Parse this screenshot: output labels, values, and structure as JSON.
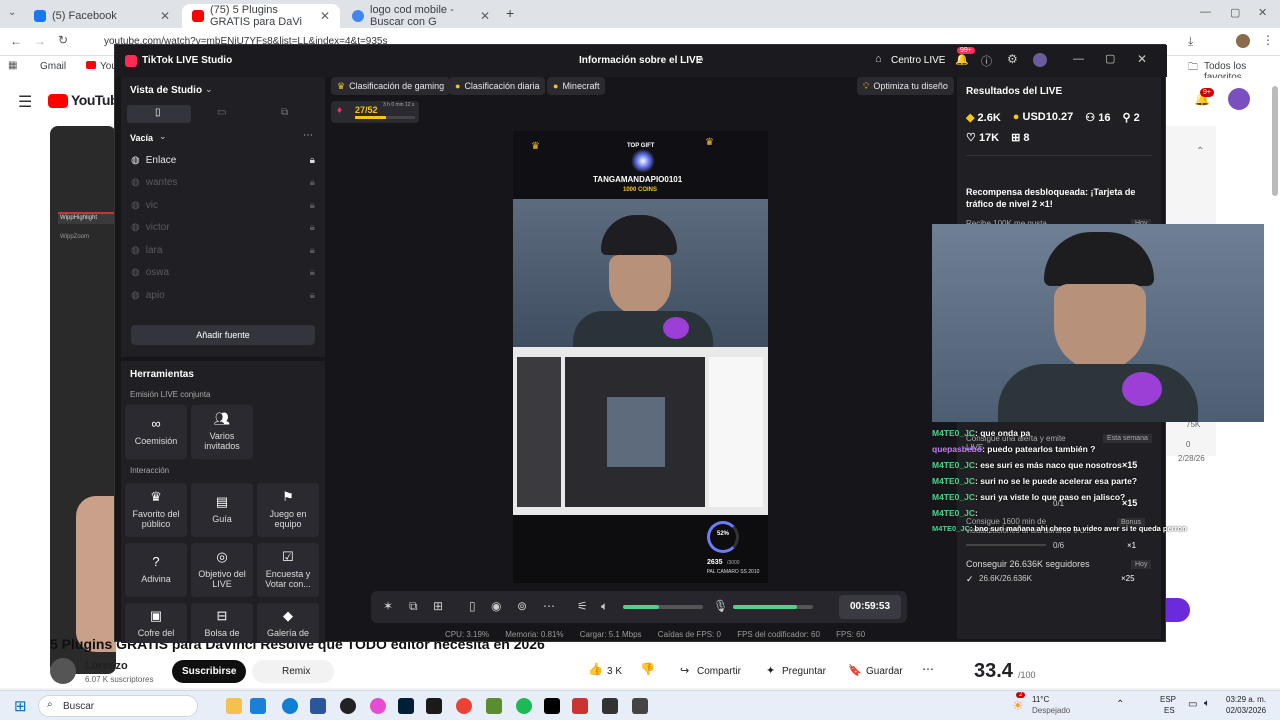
{
  "browser": {
    "tabs": [
      {
        "label": "(5) Facebook",
        "color": "#1877f2"
      },
      {
        "label": "(75) 5 Plugins GRATIS para DaVi",
        "color": "#ff0000"
      },
      {
        "label": "logo cod mobile - Buscar con G",
        "color": "#4285f4"
      }
    ],
    "url": "youtube.com/watch?v=mbENiU7YFs8&list=LL&index=4&t=935s",
    "bookmarks": [
      "Gmail",
      "You"
    ],
    "all_bookmarks": "Todos los favoritos"
  },
  "youtube": {
    "logo": "YouTube",
    "notif_badge": "9+",
    "video_title": "5 Plugins GRATIS para DaVinci Resolve que TODO editor necesita en 2026",
    "channel": "Lorenzo",
    "subs": "6.07 K suscriptores",
    "subscribe": "Suscribirse",
    "remix": "Remix",
    "likes": "3 K",
    "share": "Compartir",
    "ask": "Preguntar",
    "save": "Guardar",
    "score": "33.4",
    "score_unit": "/100",
    "side_vals": [
      "75K",
      "0",
      "2/28/26"
    ],
    "thumb_labels": [
      "WippHighlight",
      "WippZoom"
    ]
  },
  "studio": {
    "app_title": "TikTok LIVE Studio",
    "center_title": "Información sobre el LIVE",
    "centro_live": "Centro LIVE",
    "notif_badge": "99+",
    "view_label": "Vista de Studio",
    "scene_label": "Vacía",
    "sources": [
      {
        "name": "Enlace",
        "active": true
      },
      {
        "name": "wantes",
        "active": false
      },
      {
        "name": "vic",
        "active": false
      },
      {
        "name": "victor",
        "active": false
      },
      {
        "name": "lara",
        "active": false
      },
      {
        "name": "oswa",
        "active": false
      },
      {
        "name": "apio",
        "active": false
      }
    ],
    "add_source": "Añadir fuente",
    "tools_title": "Herramientas",
    "section_joint": "Emisión LIVE conjunta",
    "joint_tools": [
      "Coemisión",
      "Varios invitados"
    ],
    "section_interaction": "Interacción",
    "interaction_tools": [
      "Favorito del público",
      "Guía",
      "Juego en equipo",
      "Adivina",
      "Objetivo del LIVE",
      "Encuesta y Votar con...",
      "Cofre del",
      "Bolsa de",
      "Galería de"
    ],
    "chips": [
      "Clasificación de gaming",
      "Clasificación diaria",
      "Minecraft"
    ],
    "optimize": "Optimiza tu diseño",
    "rank": "27/52",
    "rank_time": "3 h 0 min 12 s",
    "preview": {
      "top_gift": "TOP GIFT",
      "gifter": "TANGAMANDAPIO0101",
      "coins": "1000 COINS",
      "score": "2635",
      "score_max": "/3000",
      "score_pct": "52%",
      "goal": "PAL CAMARO SS 2010"
    },
    "results_title": "Resultados del LIVE",
    "stats": {
      "diamonds": "2.6K",
      "usd": "USD10.27",
      "viewers": "16",
      "new": "2",
      "likes": "17K",
      "gifts": "8"
    },
    "reward_title": "Recompensa desbloqueada: ¡Tarjeta de tráfico de nivel 2 ×1!",
    "reward_sub": "Recibe 100K me gusta",
    "reward_tag": "Hoy",
    "tasks": [
      {
        "text": "Consigue una alerta y emite LIVE",
        "tag": "Esta semana",
        "progress": "0/1",
        "reward": "×15"
      },
      {
        "text": "Consigue 1600 min de visualizaciones al día durante 6 d...",
        "tag": "Bonus",
        "progress": "0/6",
        "reward": "×1"
      },
      {
        "text": "Conseguir 26.636K seguidores",
        "tag": "Hoy",
        "progress": "26.6K/26.636K",
        "reward": "×25"
      }
    ],
    "timer": "00:59:53",
    "slider_mic": 0.8,
    "slider_vol": 0.45,
    "footer": {
      "cpu": "CPU: 3.19%",
      "mem": "Memoria: 0.81%",
      "load": "Cargar: 5.1 Mbps",
      "drops": "Caídas de FPS: 0",
      "encfps": "FPS del codificador: 60",
      "fps": "FPS: 60"
    }
  },
  "chat": [
    {
      "user": "M4TE0_JC",
      "msg": ": que onda pa"
    },
    {
      "user": "quepasbebo",
      "msg": ": puedo patearlos también ?"
    },
    {
      "user": "M4TE0_JC",
      "msg": ": ese suri es más naco que nosotros"
    },
    {
      "user": "M4TE0_JC",
      "msg": ": suri no se le puede acelerar esa parte?"
    },
    {
      "user": "M4TE0_JC",
      "msg": ": suri ya viste lo que paso en jalisco?"
    },
    {
      "user": "M4TE0_JC",
      "msg": ": "
    },
    {
      "user": "M4TE0_JC",
      "msg": ": bno suri mañana ahi checo tu video aver si te queda perron"
    }
  ],
  "taskbar": {
    "search": "Buscar",
    "temp": "11°C",
    "weather": "Despejado",
    "weather_badge": "2",
    "lang1": "ESP",
    "lang2": "ES",
    "time": "03:29 a. m.",
    "date": "02/03/2026"
  }
}
